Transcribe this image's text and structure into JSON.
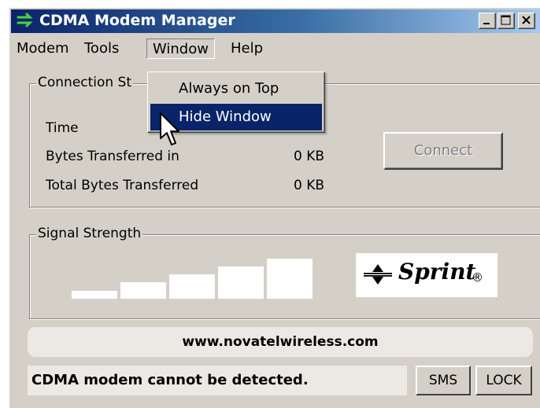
{
  "window": {
    "title": "CDMA Modem Manager",
    "title_icon": "arrow-icon",
    "controls": {
      "minimize_icon": "minimize-icon",
      "maximize_icon": "maximize-icon",
      "close_icon": "close-icon"
    }
  },
  "menubar": {
    "items": [
      {
        "label": "Modem"
      },
      {
        "label": "Tools"
      },
      {
        "label": "Window"
      },
      {
        "label": "Help"
      }
    ]
  },
  "window_menu": {
    "items": [
      {
        "label": "Always on Top",
        "selected": false
      },
      {
        "label": "Hide Window",
        "selected": true
      }
    ]
  },
  "connection": {
    "legend": "Connection St",
    "stats": [
      {
        "label": "Time",
        "value": ""
      },
      {
        "label": "Bytes Transferred in",
        "value": "0 KB"
      },
      {
        "label": "Total Bytes Transferred",
        "value": "0 KB"
      }
    ],
    "connect_label": "Connect",
    "connect_enabled": false
  },
  "signal": {
    "legend": "Signal Strength",
    "bars_total": 5,
    "logo_text": "Sprint",
    "logo_reg": "®"
  },
  "footer": {
    "url": "www.novatelwireless.com",
    "status": "CDMA modem cannot be detected.",
    "sms_label": "SMS",
    "lock_label": "LOCK"
  },
  "colors": {
    "titlebar_start": "#0a246a",
    "titlebar_end": "#a6caf0",
    "window_bg": "#d4d0c8",
    "menu_highlight": "#0a246a",
    "icon_green": "#4fd23a"
  }
}
